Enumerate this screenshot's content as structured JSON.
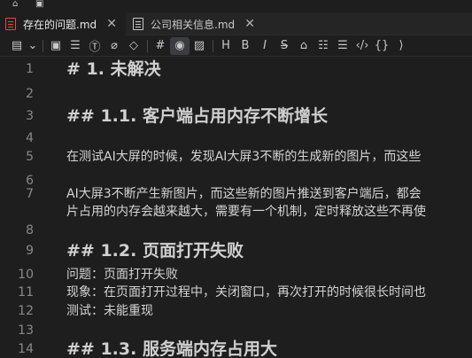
{
  "tabs": [
    {
      "label": "存在的问题.md",
      "active": true
    },
    {
      "label": "公司相关信息.md",
      "active": false
    }
  ],
  "toolbar": {
    "icons": [
      "file-menu-icon",
      "chevron-down-icon",
      "save-icon",
      "list-icon",
      "text-format-icon",
      "attach-icon",
      "tag-icon",
      "hash-icon",
      "eye-icon",
      "image-icon",
      "heading-icon",
      "bold-icon",
      "italic-icon",
      "strikethrough-icon",
      "lock-icon",
      "bullet-list-icon",
      "numbered-list-icon",
      "code-icon",
      "braces-icon"
    ]
  },
  "editor": {
    "lines": [
      {
        "num": "1",
        "text": "# 1. 未解决",
        "heading": true
      },
      {
        "num": "2",
        "text": "",
        "heading": false
      },
      {
        "num": "3",
        "text": "## 1.1. 客户端占用内存不断增长",
        "heading": true
      },
      {
        "num": "4",
        "text": "",
        "heading": false
      },
      {
        "num": "5",
        "text": "在测试AI大屏的时候，发现AI大屏3不断的生成新的图片，而这些",
        "heading": false
      },
      {
        "num": "6",
        "text": "",
        "heading": false
      },
      {
        "num": "7",
        "text": "AI大屏3不断产生新图片，而这些新的图片推送到客户端后，都会",
        "heading": false
      },
      {
        "num": "",
        "text": "片占用的内存会越来越大，需要有一个机制，定时释放这些不再使",
        "heading": false
      },
      {
        "num": "8",
        "text": "",
        "heading": false
      },
      {
        "num": "9",
        "text": "## 1.2. 页面打开失败",
        "heading": true
      },
      {
        "num": "10",
        "text": "问题：页面打开失败",
        "heading": false
      },
      {
        "num": "11",
        "text": "现象：在页面打开过程中，关闭窗口，再次打开的时候很长时间也",
        "heading": false
      },
      {
        "num": "12",
        "text": "测试：未能重现",
        "heading": false
      },
      {
        "num": "13",
        "text": "",
        "heading": false
      },
      {
        "num": "14",
        "text": "## 1.3. 服务端内存占用大",
        "heading": true
      }
    ]
  }
}
